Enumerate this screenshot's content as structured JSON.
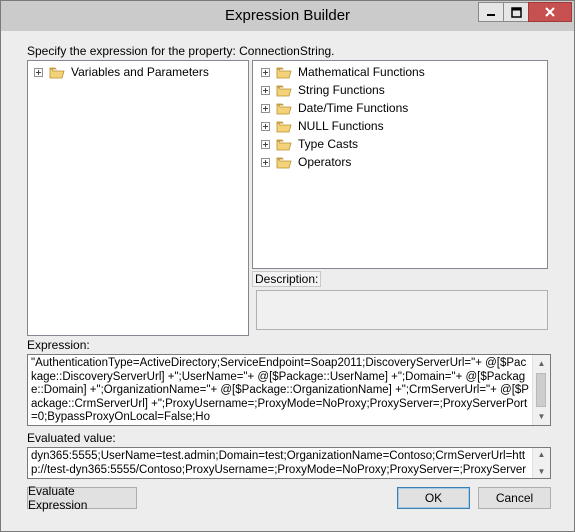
{
  "window": {
    "title": "Expression Builder"
  },
  "prompt": "Specify the expression for the property: ConnectionString.",
  "left_tree": {
    "items": [
      {
        "label": "Variables and Parameters"
      }
    ]
  },
  "right_tree": {
    "items": [
      {
        "label": "Mathematical Functions"
      },
      {
        "label": "String Functions"
      },
      {
        "label": "Date/Time Functions"
      },
      {
        "label": "NULL Functions"
      },
      {
        "label": "Type Casts"
      },
      {
        "label": "Operators"
      }
    ]
  },
  "description": {
    "label": "Description:",
    "value": ""
  },
  "expression": {
    "label": "Expression:",
    "value": "\"AuthenticationType=ActiveDirectory;ServiceEndpoint=Soap2011;DiscoveryServerUrl=\"+ @[$Package::DiscoveryServerUrl] +\";UserName=\"+ @[$Package::UserName] +\";Domain=\"+ @[$Package::Domain] +\";OrganizationName=\"+ @[$Package::OrganizationName] +\";CrmServerUrl=\"+ @[$Package::CrmServerUrl] +\";ProxyUsername=;ProxyMode=NoProxy;ProxyServer=;ProxyServerPort=0;BypassProxyOnLocal=False;Ho"
  },
  "evaluated": {
    "label": "Evaluated value:",
    "value": "dyn365:5555;UserName=test.admin;Domain=test;OrganizationName=Contoso;CrmServerUrl=http://test-dyn365:5555/Contoso;ProxyUsername=;ProxyMode=NoProxy;ProxyServer=;ProxyServerPort=0;BypassProx"
  },
  "buttons": {
    "evaluate": "Evaluate Expression",
    "ok": "OK",
    "cancel": "Cancel"
  },
  "icons": {
    "folder": "folder-icon",
    "expander": "plus-expander-icon",
    "minimize": "minimize-icon",
    "maximize": "maximize-icon",
    "close": "close-icon"
  },
  "colors": {
    "titlebar": "#cbcbcb",
    "close_button": "#c75050",
    "folder": "#e8c35a",
    "default_button_border": "#3c7fb1"
  }
}
